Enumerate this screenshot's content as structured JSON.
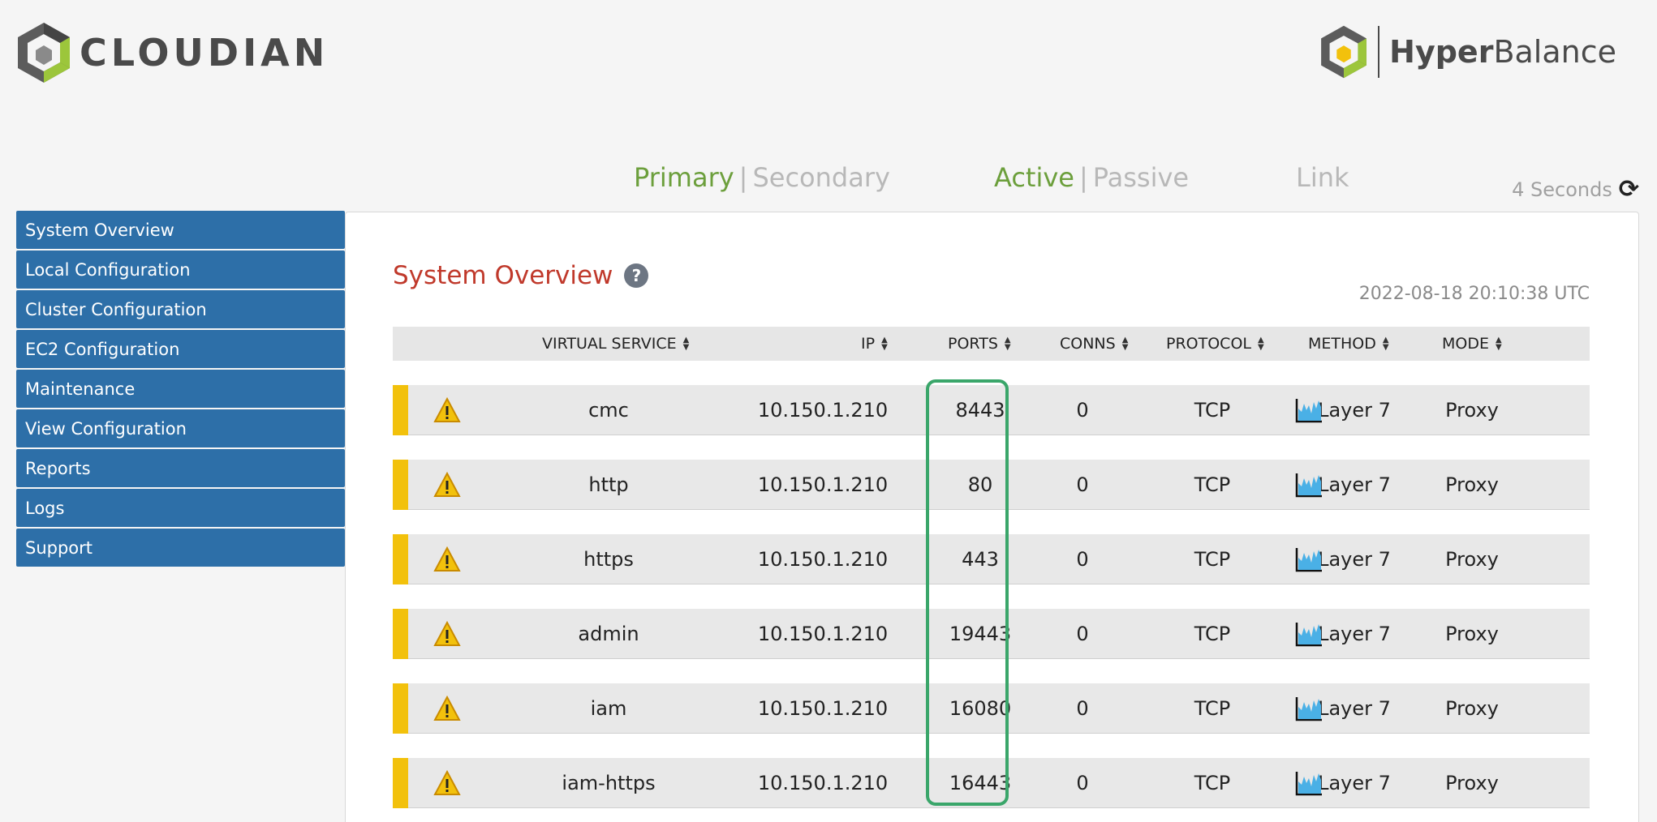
{
  "brand": {
    "left_logo": "CLOUDIAN",
    "right_logo_bold": "Hyper",
    "right_logo_regular": "Balance"
  },
  "status": {
    "role_active": "Primary",
    "role_inactive": "Secondary",
    "state_active": "Active",
    "state_inactive": "Passive",
    "link": "Link",
    "refresh_text": "4 Seconds"
  },
  "sidebar": {
    "items": [
      {
        "label": "System Overview"
      },
      {
        "label": "Local Configuration"
      },
      {
        "label": "Cluster Configuration"
      },
      {
        "label": "EC2 Configuration"
      },
      {
        "label": "Maintenance"
      },
      {
        "label": "View Configuration"
      },
      {
        "label": "Reports"
      },
      {
        "label": "Logs"
      },
      {
        "label": "Support"
      }
    ]
  },
  "main": {
    "title": "System Overview",
    "help": "?",
    "timestamp": "2022-08-18 20:10:38 UTC",
    "columns": {
      "virtual_service": "VIRTUAL SERVICE",
      "ip": "IP",
      "ports": "PORTS",
      "conns": "CONNS",
      "protocol": "PROTOCOL",
      "method": "METHOD",
      "mode": "MODE"
    },
    "rows": [
      {
        "service": "cmc",
        "ip": "10.150.1.210",
        "port": "8443",
        "conns": "0",
        "protocol": "TCP",
        "method": "Layer 7",
        "mode": "Proxy"
      },
      {
        "service": "http",
        "ip": "10.150.1.210",
        "port": "80",
        "conns": "0",
        "protocol": "TCP",
        "method": "Layer 7",
        "mode": "Proxy"
      },
      {
        "service": "https",
        "ip": "10.150.1.210",
        "port": "443",
        "conns": "0",
        "protocol": "TCP",
        "method": "Layer 7",
        "mode": "Proxy"
      },
      {
        "service": "admin",
        "ip": "10.150.1.210",
        "port": "19443",
        "conns": "0",
        "protocol": "TCP",
        "method": "Layer 7",
        "mode": "Proxy"
      },
      {
        "service": "iam",
        "ip": "10.150.1.210",
        "port": "16080",
        "conns": "0",
        "protocol": "TCP",
        "method": "Layer 7",
        "mode": "Proxy"
      },
      {
        "service": "iam-https",
        "ip": "10.150.1.210",
        "port": "16443",
        "conns": "0",
        "protocol": "TCP",
        "method": "Layer 7",
        "mode": "Proxy"
      }
    ]
  },
  "colors": {
    "nav_blue": "#2d6fa8",
    "title_red": "#c0392b",
    "active_green": "#6c9f3c",
    "warning_yellow": "#f2c10c",
    "highlight_green": "#3aa66a"
  },
  "icons": {
    "status": "warning-icon",
    "stats": "chart-icon",
    "refresh": "refresh-icon"
  }
}
